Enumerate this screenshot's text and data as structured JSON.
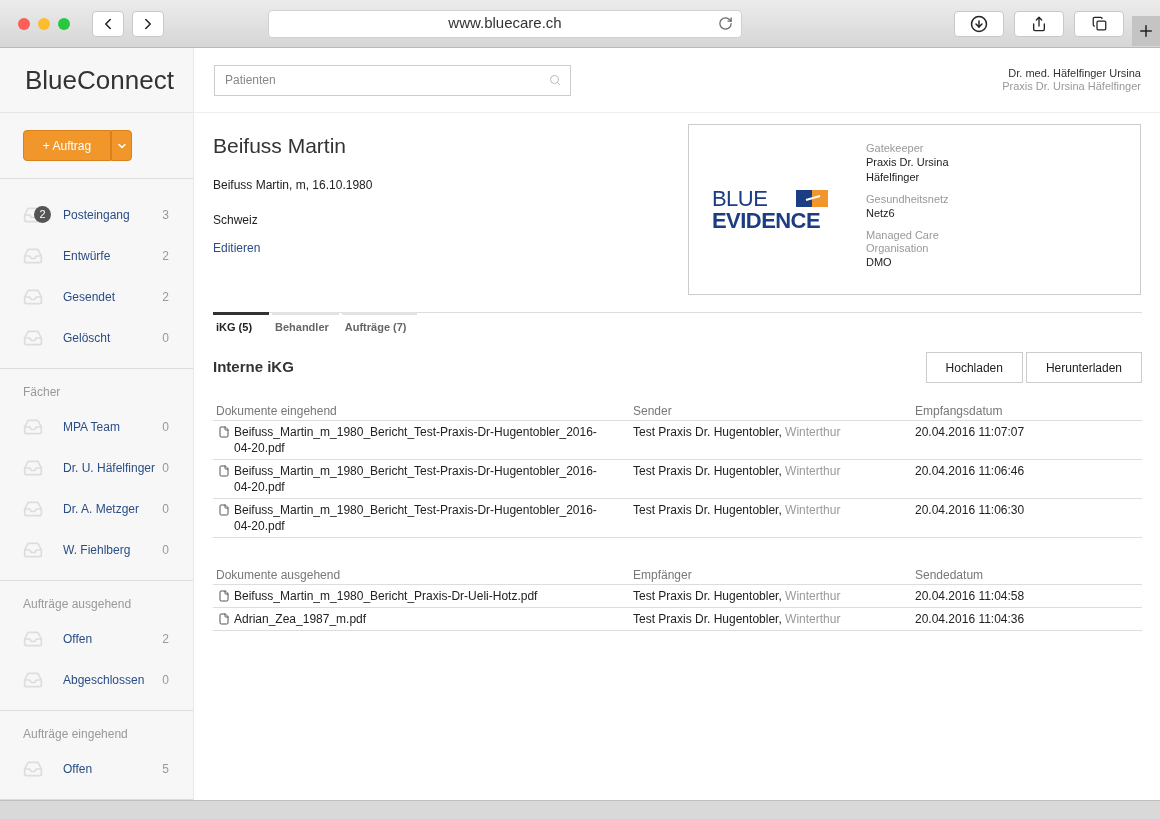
{
  "browser": {
    "url": "www.bluecare.ch"
  },
  "app": {
    "brand": "BlueConnect",
    "search": {
      "placeholder": "Patienten"
    },
    "user": {
      "name": "Dr. med. Häfelfinger Ursina",
      "practice": "Praxis Dr. Ursina Häfelfinger"
    }
  },
  "new_button": {
    "label": "+ Auftrag"
  },
  "sidebar": [
    {
      "items": [
        {
          "label": "Posteingang",
          "count": "3",
          "badge": "2"
        },
        {
          "label": "Entwürfe",
          "count": "2"
        },
        {
          "label": "Gesendet",
          "count": "2"
        },
        {
          "label": "Gelöscht",
          "count": "0"
        }
      ]
    },
    {
      "title": "Fächer",
      "items": [
        {
          "label": "MPA Team",
          "count": "0"
        },
        {
          "label": "Dr. U. Häfelfinger",
          "count": "0"
        },
        {
          "label": "Dr. A. Metzger",
          "count": "0"
        },
        {
          "label": "W. Fiehlberg",
          "count": "0"
        }
      ]
    },
    {
      "title": "Aufträge ausgehend",
      "items": [
        {
          "label": "Offen",
          "count": "2"
        },
        {
          "label": "Abgeschlossen",
          "count": "0"
        }
      ]
    },
    {
      "title": "Aufträge eingehend",
      "items": [
        {
          "label": "Offen",
          "count": "5"
        }
      ]
    }
  ],
  "patient": {
    "name": "Beifuss Martin",
    "details": "Beifuss Martin, m, 16.10.1980",
    "country": "Schweiz",
    "edit_link": "Editieren"
  },
  "card": {
    "logo": {
      "line1": "BLUE",
      "line2": "EVIDENCE"
    },
    "fields": [
      {
        "label": "Gatekeeper",
        "value": "Praxis Dr. Ursina Häfelfinger"
      },
      {
        "label": "Gesundheitsnetz",
        "value": "Netz6"
      },
      {
        "label": "Managed Care Organisation",
        "value": "DMO"
      }
    ]
  },
  "tabs": [
    {
      "label": "iKG (5)",
      "selected": true
    },
    {
      "label": "Behandler",
      "selected": false
    },
    {
      "label": "Aufträge (7)",
      "selected": false
    }
  ],
  "section": {
    "title": "Interne iKG",
    "buttons": [
      "Hochladen",
      "Herunterladen"
    ]
  },
  "tables": [
    {
      "columns": [
        "Dokumente eingehend",
        "Sender",
        "Empfangsdatum"
      ],
      "rows": [
        {
          "file": "Beifuss_Martin_m_1980_Bericht_Test-Praxis-Dr-Hugentobler_2016-04-20.pdf",
          "party": "Test Praxis Dr. Hugentobler,",
          "place": "Winterthur",
          "date": "20.04.2016 11:07:07"
        },
        {
          "file": "Beifuss_Martin_m_1980_Bericht_Test-Praxis-Dr-Hugentobler_2016-04-20.pdf",
          "party": "Test Praxis Dr. Hugentobler,",
          "place": "Winterthur",
          "date": "20.04.2016 11:06:46"
        },
        {
          "file": "Beifuss_Martin_m_1980_Bericht_Test-Praxis-Dr-Hugentobler_2016-04-20.pdf",
          "party": "Test Praxis Dr. Hugentobler,",
          "place": "Winterthur",
          "date": "20.04.2016 11:06:30"
        }
      ]
    },
    {
      "columns": [
        "Dokumente ausgehend",
        "Empfänger",
        "Sendedatum"
      ],
      "rows": [
        {
          "file": "Beifuss_Martin_m_1980_Bericht_Praxis-Dr-Ueli-Hotz.pdf",
          "party": "Test Praxis Dr. Hugentobler,",
          "place": "Winterthur",
          "date": "20.04.2016 11:04:58"
        },
        {
          "file": "Adrian_Zea_1987_m.pdf",
          "party": "Test Praxis Dr. Hugentobler,",
          "place": "Winterthur",
          "date": "20.04.2016 11:04:36"
        }
      ]
    }
  ]
}
